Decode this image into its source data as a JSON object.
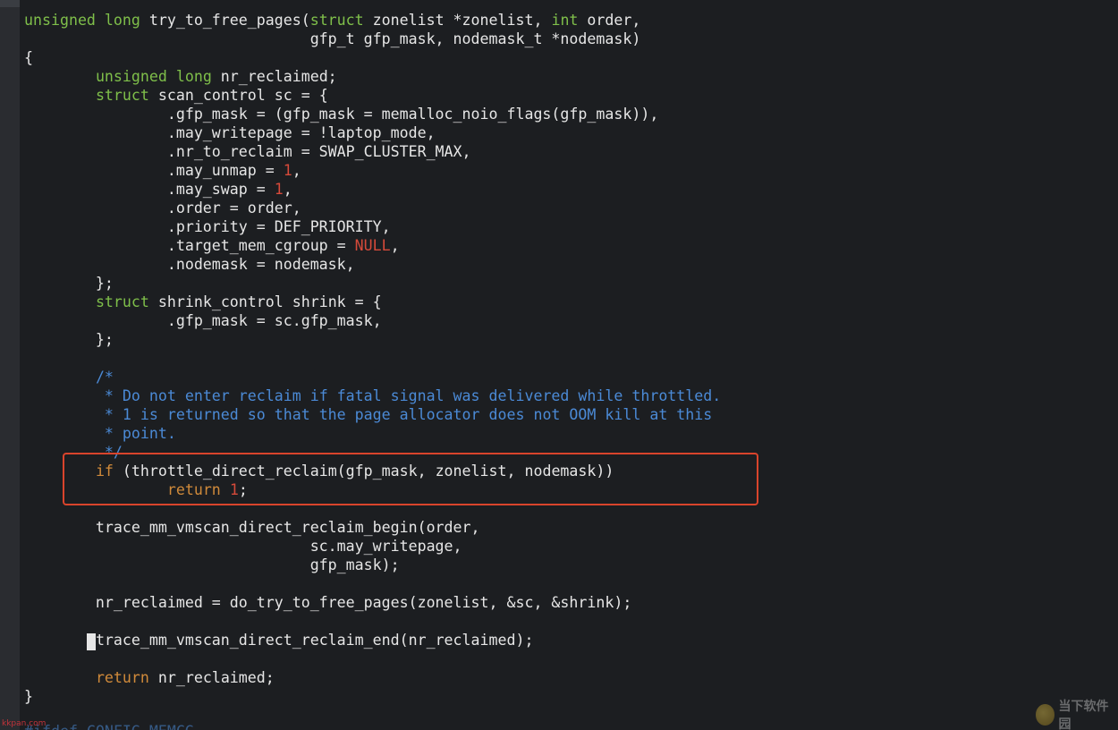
{
  "editor": {
    "code_lines": [
      [
        {
          "t": "unsigned long",
          "c": "type"
        },
        {
          "t": " try_to_free_pages(",
          "c": ""
        },
        {
          "t": "struct",
          "c": "type"
        },
        {
          "t": " zonelist *zonelist, ",
          "c": ""
        },
        {
          "t": "int",
          "c": "type"
        },
        {
          "t": " order,",
          "c": ""
        }
      ],
      [
        {
          "t": "                                gfp_t gfp_mask, nodemask_t *nodemask)",
          "c": ""
        }
      ],
      [
        {
          "t": "{",
          "c": ""
        }
      ],
      [
        {
          "t": "        ",
          "c": ""
        },
        {
          "t": "unsigned long",
          "c": "type"
        },
        {
          "t": " nr_reclaimed;",
          "c": ""
        }
      ],
      [
        {
          "t": "        ",
          "c": ""
        },
        {
          "t": "struct",
          "c": "type"
        },
        {
          "t": " scan_control sc = {",
          "c": ""
        }
      ],
      [
        {
          "t": "                .gfp_mask = (gfp_mask = memalloc_noio_flags(gfp_mask)),",
          "c": ""
        }
      ],
      [
        {
          "t": "                .may_writepage = !laptop_mode,",
          "c": ""
        }
      ],
      [
        {
          "t": "                .nr_to_reclaim = SWAP_CLUSTER_MAX,",
          "c": ""
        }
      ],
      [
        {
          "t": "                .may_unmap = ",
          "c": ""
        },
        {
          "t": "1",
          "c": "num"
        },
        {
          "t": ",",
          "c": ""
        }
      ],
      [
        {
          "t": "                .may_swap = ",
          "c": ""
        },
        {
          "t": "1",
          "c": "num"
        },
        {
          "t": ",",
          "c": ""
        }
      ],
      [
        {
          "t": "                .order = order,",
          "c": ""
        }
      ],
      [
        {
          "t": "                .priority = DEF_PRIORITY,",
          "c": ""
        }
      ],
      [
        {
          "t": "                .target_mem_cgroup = ",
          "c": ""
        },
        {
          "t": "NULL",
          "c": "num"
        },
        {
          "t": ",",
          "c": ""
        }
      ],
      [
        {
          "t": "                .nodemask = nodemask,",
          "c": ""
        }
      ],
      [
        {
          "t": "        };",
          "c": ""
        }
      ],
      [
        {
          "t": "        ",
          "c": ""
        },
        {
          "t": "struct",
          "c": "type"
        },
        {
          "t": " shrink_control shrink = {",
          "c": ""
        }
      ],
      [
        {
          "t": "                .gfp_mask = sc.gfp_mask,",
          "c": ""
        }
      ],
      [
        {
          "t": "        };",
          "c": ""
        }
      ],
      [
        {
          "t": "",
          "c": ""
        }
      ],
      [
        {
          "t": "        ",
          "c": ""
        },
        {
          "t": "/*",
          "c": "com"
        }
      ],
      [
        {
          "t": "         ",
          "c": ""
        },
        {
          "t": "* Do not enter reclaim if fatal signal was delivered while throttled.",
          "c": "com"
        }
      ],
      [
        {
          "t": "         ",
          "c": ""
        },
        {
          "t": "* 1 is returned so that the page allocator does not OOM kill at this",
          "c": "com"
        }
      ],
      [
        {
          "t": "         ",
          "c": ""
        },
        {
          "t": "* point.",
          "c": "com"
        }
      ],
      [
        {
          "t": "         ",
          "c": ""
        },
        {
          "t": "*/",
          "c": "com"
        }
      ],
      [
        {
          "t": "        ",
          "c": ""
        },
        {
          "t": "if",
          "c": "kw"
        },
        {
          "t": " (throttle_direct_reclaim(gfp_mask, zonelist, nodemask))",
          "c": ""
        }
      ],
      [
        {
          "t": "                ",
          "c": ""
        },
        {
          "t": "return",
          "c": "kw"
        },
        {
          "t": " ",
          "c": ""
        },
        {
          "t": "1",
          "c": "num"
        },
        {
          "t": ";",
          "c": ""
        }
      ],
      [
        {
          "t": "",
          "c": ""
        }
      ],
      [
        {
          "t": "        trace_mm_vmscan_direct_reclaim_begin(order,",
          "c": ""
        }
      ],
      [
        {
          "t": "                                sc.may_writepage,",
          "c": ""
        }
      ],
      [
        {
          "t": "                                gfp_mask);",
          "c": ""
        }
      ],
      [
        {
          "t": "",
          "c": ""
        }
      ],
      [
        {
          "t": "        nr_reclaimed = do_try_to_free_pages(zonelist, &sc, &shrink);",
          "c": ""
        }
      ],
      [
        {
          "t": "",
          "c": ""
        }
      ],
      [
        {
          "t": "       ",
          "c": ""
        },
        {
          "t": " ",
          "c": "cursor"
        },
        {
          "t": "trace_mm_vmscan_direct_reclaim_end(nr_reclaimed);",
          "c": ""
        }
      ],
      [
        {
          "t": "",
          "c": ""
        }
      ],
      [
        {
          "t": "        ",
          "c": ""
        },
        {
          "t": "return",
          "c": "kw"
        },
        {
          "t": " nr_reclaimed;",
          "c": ""
        }
      ],
      [
        {
          "t": "}",
          "c": ""
        }
      ]
    ],
    "partial_last_line": "#ifdef CONFIG_MEMCG"
  },
  "watermarks": {
    "left": "kkpan.com",
    "right": "当下软件园"
  },
  "colors": {
    "background": "#1c1e21",
    "text": "#e6e6e6",
    "type": "#7fbf4a",
    "keyword": "#d08a3a",
    "literal": "#d64a3a",
    "comment": "#4b8ad6",
    "highlight_box": "#d9442c"
  }
}
